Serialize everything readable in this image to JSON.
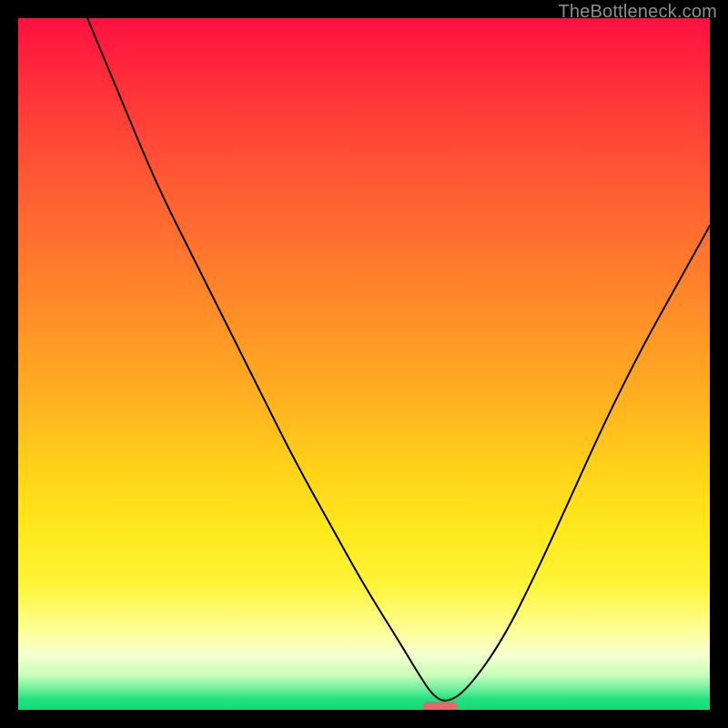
{
  "watermark": "TheBottleneck.com",
  "colors": {
    "frame_bg": "#000000",
    "gradient_top": "#ff1040",
    "gradient_bottom": "#17db76",
    "curve": "#000000",
    "marker": "#e36a6a",
    "watermark_text": "#8d8d8d"
  },
  "chart_data": {
    "type": "line",
    "title": "",
    "xlabel": "",
    "ylabel": "",
    "xlim": [
      0,
      100
    ],
    "ylim": [
      0,
      100
    ],
    "annotations": [],
    "series": [
      {
        "name": "bottleneck-curve",
        "x": [
          10,
          15,
          20,
          25,
          30,
          35,
          40,
          45,
          50,
          55,
          58,
          60,
          62,
          65,
          70,
          75,
          80,
          85,
          90,
          95,
          100
        ],
        "values": [
          100,
          88,
          76,
          66,
          56,
          46,
          36,
          27,
          18,
          10,
          5,
          2,
          1,
          3,
          10,
          20,
          31,
          42,
          52,
          61,
          70
        ]
      }
    ],
    "marker": {
      "x": 61,
      "y": 0.4,
      "shape": "rounded-bar",
      "color": "#e36a6a"
    }
  }
}
